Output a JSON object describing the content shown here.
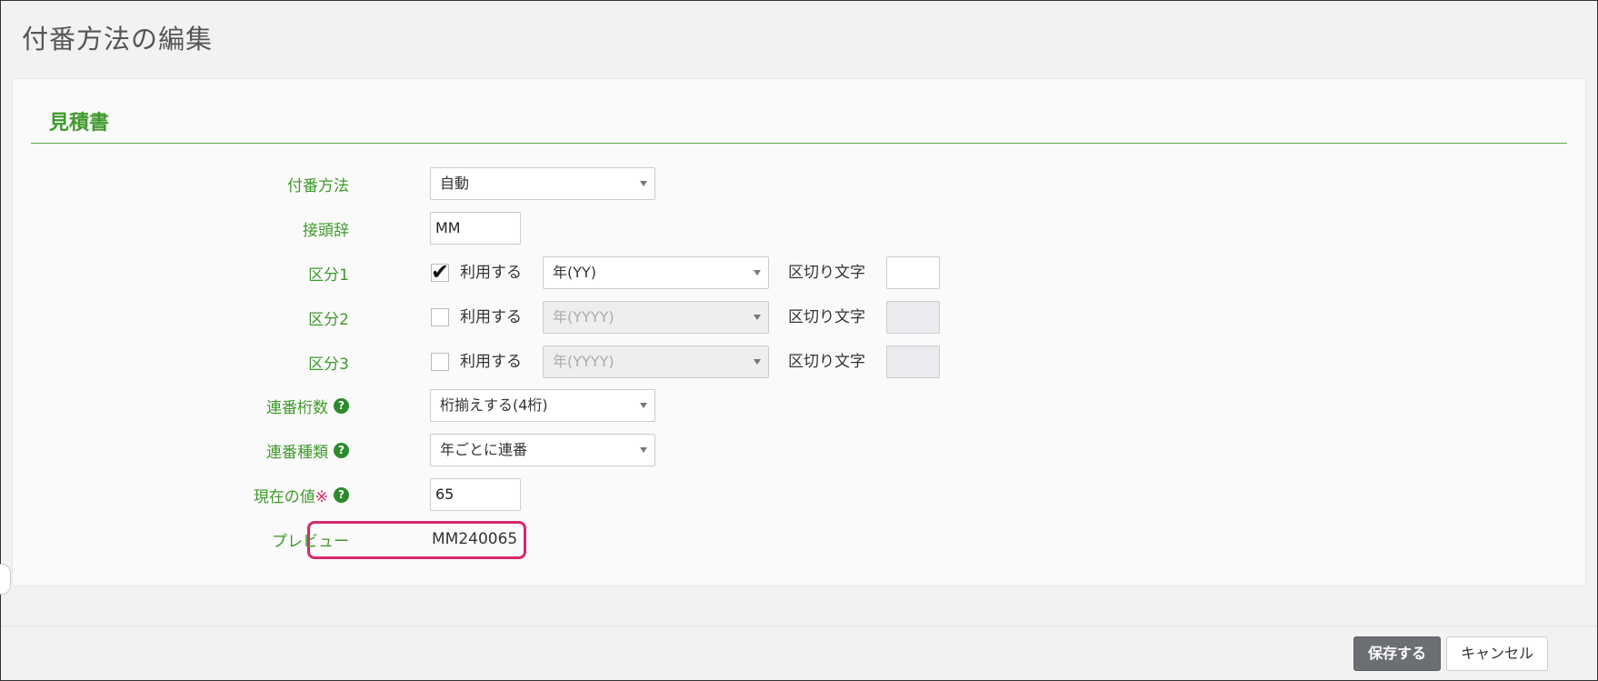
{
  "page": {
    "title": "付番方法の編集"
  },
  "section": {
    "title": "見積書"
  },
  "form": {
    "numbering_method": {
      "label": "付番方法",
      "value": "自動"
    },
    "prefix": {
      "label": "接頭辞",
      "value": "MM"
    },
    "segment1": {
      "label": "区分1",
      "use_label": "利用する",
      "checked": true,
      "value": "年(YY)",
      "separator_label": "区切り文字",
      "separator_value": ""
    },
    "segment2": {
      "label": "区分2",
      "use_label": "利用する",
      "checked": false,
      "value": "年(YYYY)",
      "separator_label": "区切り文字",
      "separator_value": ""
    },
    "segment3": {
      "label": "区分3",
      "use_label": "利用する",
      "checked": false,
      "value": "年(YYYY)",
      "separator_label": "区切り文字",
      "separator_value": ""
    },
    "serial_digits": {
      "label": "連番桁数",
      "value": "桁揃えする(4桁)",
      "help_icon": "question-circle-icon"
    },
    "serial_type": {
      "label": "連番種類",
      "value": "年ごとに連番",
      "help_icon": "question-circle-icon"
    },
    "current_value": {
      "label": "現在の値",
      "required_mark": "※",
      "value": "65",
      "help_icon": "question-circle-icon"
    },
    "preview": {
      "label": "プレビュー",
      "value": "MM240065"
    }
  },
  "footer": {
    "save_label": "保存する",
    "cancel_label": "キャンセル"
  },
  "colors": {
    "label_green": "#3f9a2b",
    "highlight": "#d6286f",
    "save_button": "#6b6e72"
  }
}
